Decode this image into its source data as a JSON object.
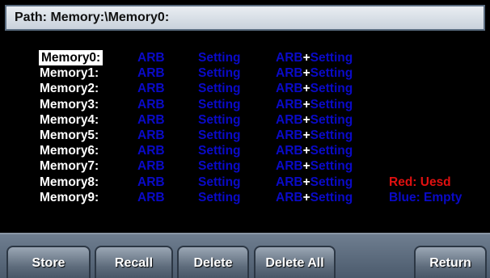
{
  "path": {
    "label": "Path: Memory:\\Memory0:"
  },
  "memory_rows": [
    {
      "name": "Memory0:",
      "arb": "ARB",
      "setting": "Setting",
      "combo_arb": "ARB",
      "combo_plus": "+",
      "combo_setting": "Setting",
      "selected": true
    },
    {
      "name": "Memory1:",
      "arb": "ARB",
      "setting": "Setting",
      "combo_arb": "ARB",
      "combo_plus": "+",
      "combo_setting": "Setting"
    },
    {
      "name": "Memory2:",
      "arb": "ARB",
      "setting": "Setting",
      "combo_arb": "ARB",
      "combo_plus": "+",
      "combo_setting": "Setting"
    },
    {
      "name": "Memory3:",
      "arb": "ARB",
      "setting": "Setting",
      "combo_arb": "ARB",
      "combo_plus": "+",
      "combo_setting": "Setting"
    },
    {
      "name": "Memory4:",
      "arb": "ARB",
      "setting": "Setting",
      "combo_arb": "ARB",
      "combo_plus": "+",
      "combo_setting": "Setting"
    },
    {
      "name": "Memory5:",
      "arb": "ARB",
      "setting": "Setting",
      "combo_arb": "ARB",
      "combo_plus": "+",
      "combo_setting": "Setting"
    },
    {
      "name": "Memory6:",
      "arb": "ARB",
      "setting": "Setting",
      "combo_arb": "ARB",
      "combo_plus": "+",
      "combo_setting": "Setting"
    },
    {
      "name": "Memory7:",
      "arb": "ARB",
      "setting": "Setting",
      "combo_arb": "ARB",
      "combo_plus": "+",
      "combo_setting": "Setting"
    },
    {
      "name": "Memory8:",
      "arb": "ARB",
      "setting": "Setting",
      "combo_arb": "ARB",
      "combo_plus": "+",
      "combo_setting": "Setting"
    },
    {
      "name": "Memory9:",
      "arb": "ARB",
      "setting": "Setting",
      "combo_arb": "ARB",
      "combo_plus": "+",
      "combo_setting": "Setting"
    }
  ],
  "legend": {
    "red": "Red: Uesd",
    "blue": "Blue: Empty"
  },
  "softkeys": {
    "store": "Store",
    "recall": "Recall",
    "delete": "Delete",
    "delete_all": "Delete All",
    "return": "Return"
  },
  "colors": {
    "empty": "#0a0ac8",
    "used": "#e01010",
    "selected_bg": "#ffffff",
    "background": "#000000"
  }
}
